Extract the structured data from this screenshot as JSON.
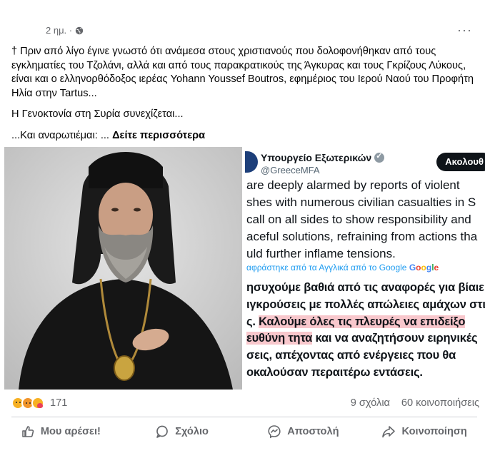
{
  "post": {
    "time": "2 ημ. ·",
    "more": "···",
    "paragraphs": [
      "† Πριν από λίγο έγινε γνωστό ότι ανάμεσα στους χριστιανούς που δολοφονήθηκαν από τους εγκληματίες του Τζολάνι, αλλά και από τους παρακρατικούς της Άγκυρας και τους Γκρίζους Λύκους, είναι και ο ελληνορθόδοξος ιερέας Yohann Youssef Boutros, εφημέριος του Ιερού Ναού του Προφήτη Ηλία στην Tartus...",
      "Η Γενοκτονία στη Συρία συνεχίζεται...",
      "...Και αναρωτιέμαι: ..."
    ],
    "see_more": "Δείτε περισσότερα"
  },
  "tweet": {
    "name": "Υπουργείο Εξωτερικών",
    "handle": "@GreeceMFA",
    "follow": "Ακολουθ",
    "en_lines": [
      "are deeply alarmed by reports of violent",
      "shes with numerous civilian casualties in S",
      "call on all sides to show responsibility and",
      "aceful solutions, refraining from actions tha",
      "uld further inflame tensions."
    ],
    "translated": "αφράστηκε από τα Αγγλικά από το Google",
    "gr_lines": [
      [
        "ησυχούμε βαθιά από τις αναφορές για βίαιε",
        ""
      ],
      [
        "ιγκρούσεις με πολλές απώλειες αμάχων στι",
        ""
      ],
      [
        "ς. ",
        "Καλούμε όλες τις πλευρές να επιδείξο"
      ],
      [
        "",
        "ευθύνη τητα",
        " και να αναζητήσουν ειρηνικές"
      ],
      [
        "σεις, απέχοντας από ενέργειες που θα",
        ""
      ],
      [
        "οκαλούσαν περαιτέρω εντάσεις.",
        ""
      ]
    ]
  },
  "stats": {
    "reaction_count": "171",
    "comments": "9 σχόλια",
    "shares": "60 κοινοποιήσεις"
  },
  "actions": {
    "like": "Μου αρέσει!",
    "comment": "Σχόλιο",
    "send": "Αποστολή",
    "share": "Κοινοποίηση"
  }
}
